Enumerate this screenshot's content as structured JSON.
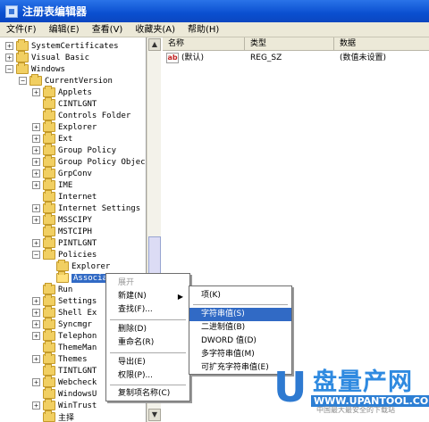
{
  "window": {
    "title": "注册表编辑器"
  },
  "menu": [
    "文件(F)",
    "编辑(E)",
    "查看(V)",
    "收藏夹(A)",
    "帮助(H)"
  ],
  "tree": [
    {
      "label": "SystemCertificates",
      "depth": 1,
      "exp": "+"
    },
    {
      "label": "Visual Basic",
      "depth": 1,
      "exp": "+"
    },
    {
      "label": "Windows",
      "depth": 1,
      "exp": "-"
    },
    {
      "label": "CurrentVersion",
      "depth": 2,
      "exp": "-"
    },
    {
      "label": "Applets",
      "depth": 3,
      "exp": "+"
    },
    {
      "label": "CINTLGNT",
      "depth": 3,
      "exp": ""
    },
    {
      "label": "Controls Folder",
      "depth": 3,
      "exp": ""
    },
    {
      "label": "Explorer",
      "depth": 3,
      "exp": "+"
    },
    {
      "label": "Ext",
      "depth": 3,
      "exp": "+"
    },
    {
      "label": "Group Policy",
      "depth": 3,
      "exp": "+"
    },
    {
      "label": "Group Policy Objec",
      "depth": 3,
      "exp": "+"
    },
    {
      "label": "GrpConv",
      "depth": 3,
      "exp": "+"
    },
    {
      "label": "IME",
      "depth": 3,
      "exp": "+"
    },
    {
      "label": "Internet",
      "depth": 3,
      "exp": ""
    },
    {
      "label": "Internet Settings",
      "depth": 3,
      "exp": "+"
    },
    {
      "label": "MSSCIPY",
      "depth": 3,
      "exp": "+"
    },
    {
      "label": "MSTCIPH",
      "depth": 3,
      "exp": ""
    },
    {
      "label": "PINTLGNT",
      "depth": 3,
      "exp": "+"
    },
    {
      "label": "Policies",
      "depth": 3,
      "exp": "-"
    },
    {
      "label": "Explorer",
      "depth": 4,
      "exp": ""
    },
    {
      "label": "Associatio",
      "depth": 4,
      "exp": "",
      "selected": true
    },
    {
      "label": "Run",
      "depth": 3,
      "exp": ""
    },
    {
      "label": "Settings",
      "depth": 3,
      "exp": "+"
    },
    {
      "label": "Shell Ex",
      "depth": 3,
      "exp": "+"
    },
    {
      "label": "Syncmgr",
      "depth": 3,
      "exp": "+"
    },
    {
      "label": "Telephon",
      "depth": 3,
      "exp": "+"
    },
    {
      "label": "ThemeMan",
      "depth": 3,
      "exp": ""
    },
    {
      "label": "Themes",
      "depth": 3,
      "exp": "+"
    },
    {
      "label": "TINTLGNT",
      "depth": 3,
      "exp": ""
    },
    {
      "label": "Webcheck",
      "depth": 3,
      "exp": "+"
    },
    {
      "label": "WindowsU",
      "depth": 3,
      "exp": ""
    },
    {
      "label": "WinTrust",
      "depth": 3,
      "exp": "+"
    },
    {
      "label": "主择",
      "depth": 3,
      "exp": ""
    }
  ],
  "list": {
    "columns": [
      "名称",
      "类型",
      "数据"
    ],
    "rows": [
      {
        "name": "(默认)",
        "type": "REG_SZ",
        "data": "(数值未设置)"
      }
    ]
  },
  "context_menu": {
    "items": [
      "展开",
      "新建(N)",
      "查找(F)...",
      "删除(D)",
      "重命名(R)",
      "导出(E)",
      "权限(P)...",
      "复制项名称(C)"
    ]
  },
  "submenu": {
    "items": [
      "项(K)",
      "字符串值(S)",
      "二进制值(B)",
      "DWORD 值(D)",
      "多字符串值(M)",
      "可扩充字符串值(E)"
    ]
  },
  "watermark": {
    "u": "U",
    "brand": "盘量产网",
    "url": "WWW.UPANTOOL.COM",
    "sub": "中国最大最安全的下载站"
  }
}
